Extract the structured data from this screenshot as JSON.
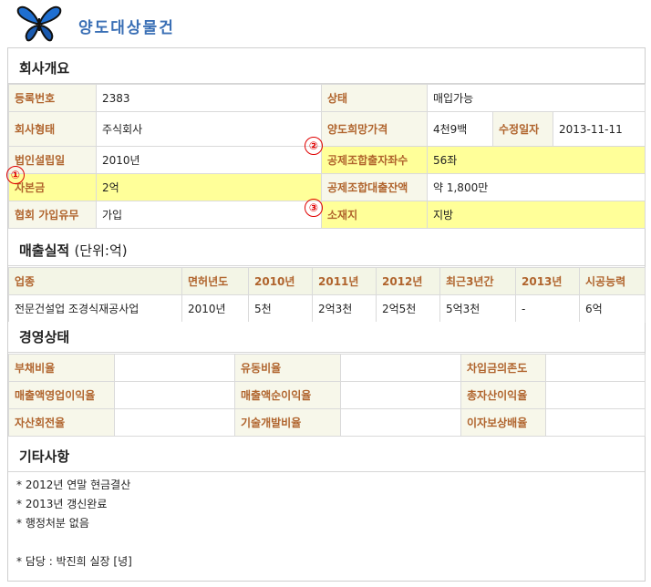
{
  "header": {
    "title": "양도대상물건"
  },
  "overview": {
    "heading": "회사개요",
    "rows": [
      {
        "l1": "등록번호",
        "v1": "2383",
        "l2": "상태",
        "v2": "매입가능"
      },
      {
        "l1": "회사형태",
        "v1": "주식회사",
        "l2": "양도희망가격",
        "v2": "4천9백",
        "l3": "수정일자",
        "v3": "2013-11-11"
      },
      {
        "l1": "법인설립일",
        "v1": "2010년",
        "l2": "공제조합출자좌수",
        "v2": "56좌"
      },
      {
        "l1": "자본금",
        "v1": "2억",
        "l2": "공제조합대출잔액",
        "v2": "약 1,800만"
      },
      {
        "l1": "협회 가입유무",
        "v1": "가입",
        "l2": "소재지",
        "v2": "지방"
      }
    ]
  },
  "markers": [
    "①",
    "②",
    "③"
  ],
  "sales": {
    "heading": "매출실적",
    "unit": "(단위:억)",
    "columns": [
      "업종",
      "면허년도",
      "2010년",
      "2011년",
      "2012년",
      "최근3년간",
      "2013년",
      "시공능력"
    ],
    "row": [
      "전문건설업 조경식재공사업",
      "2010년",
      "5천",
      "2억3천",
      "2억5천",
      "5억3천",
      "-",
      "6억"
    ]
  },
  "management": {
    "heading": "경영상태",
    "rows": [
      [
        "부채비율",
        "",
        "유동비율",
        "",
        "차입금의존도",
        ""
      ],
      [
        "매출액영업이익율",
        "",
        "매출액순이익율",
        "",
        "총자산이익율",
        ""
      ],
      [
        "자산회전율",
        "",
        "기술개발비율",
        "",
        "이자보상배율",
        ""
      ]
    ]
  },
  "other": {
    "heading": "기타사항",
    "notes": [
      "* 2012년 연말 현금결산",
      "* 2013년 갱신완료",
      "* 행정처분 없음",
      "",
      "* 담당 : 박진희 실장 [녕]"
    ]
  },
  "colors": {
    "title": "#3a6fb5",
    "label": "#b0642d",
    "highlight": "#ffff99",
    "marker": "#e00000"
  },
  "icons": {
    "logo": "butterfly-icon"
  }
}
